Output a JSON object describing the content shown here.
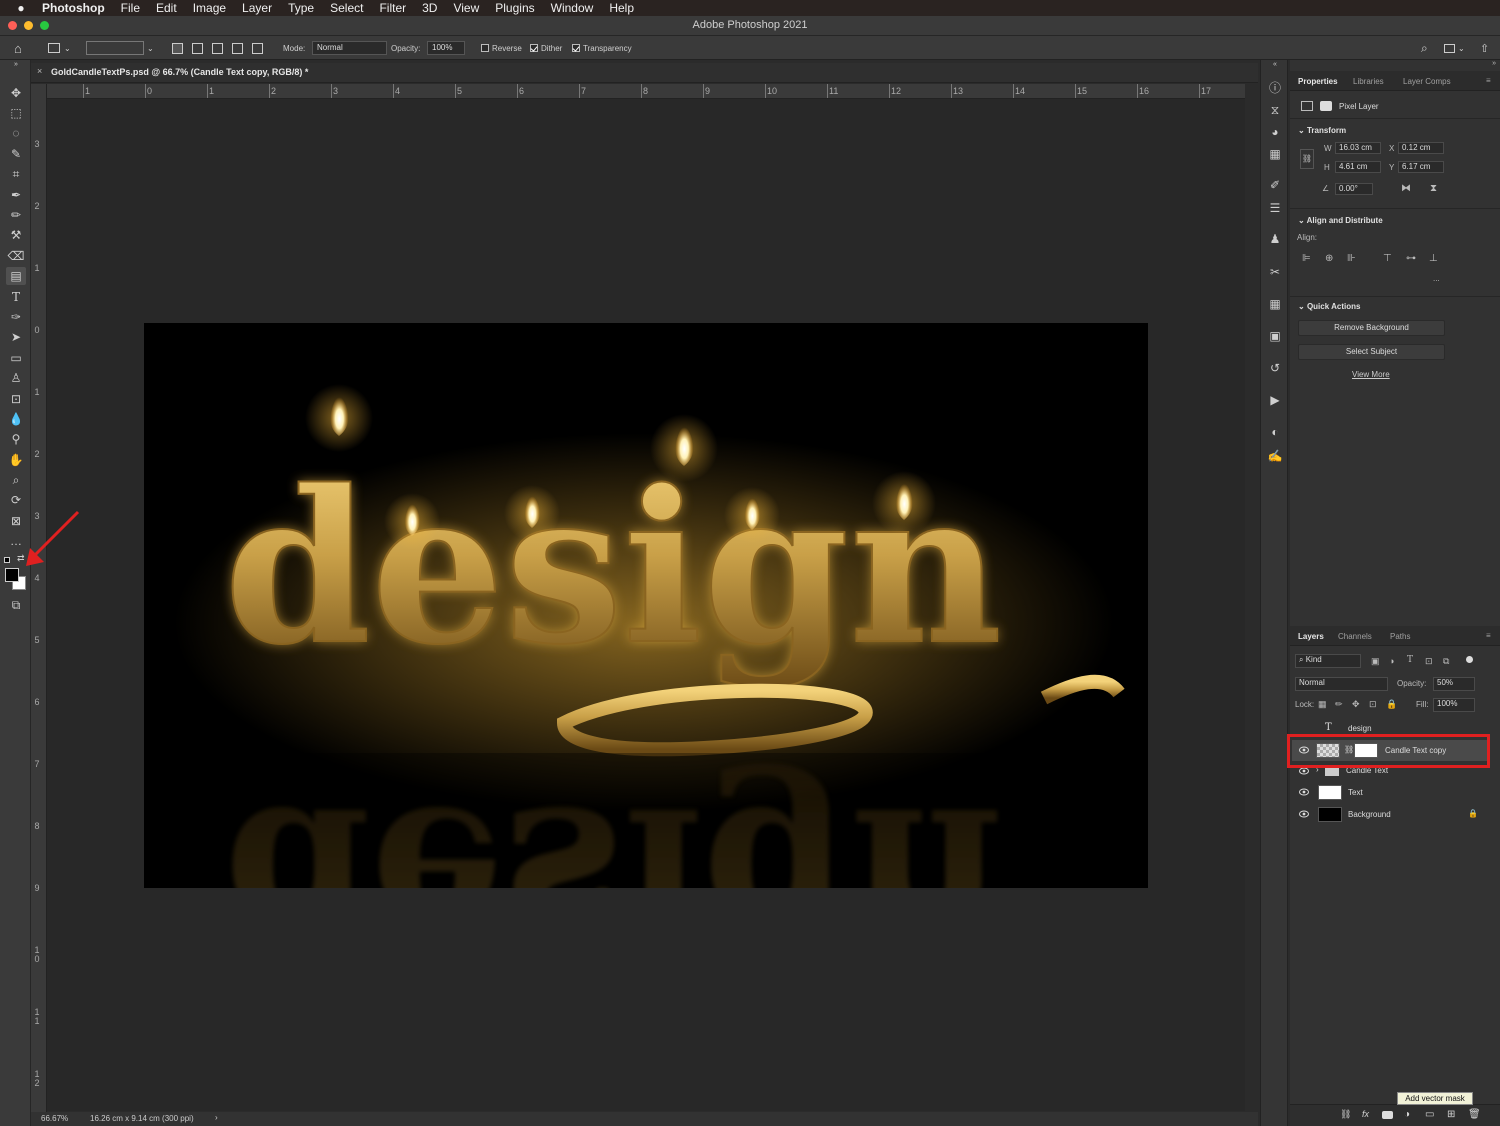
{
  "menubar": {
    "app": "Photoshop",
    "items": [
      "File",
      "Edit",
      "Image",
      "Layer",
      "Type",
      "Select",
      "Filter",
      "3D",
      "View",
      "Plugins",
      "Window",
      "Help"
    ]
  },
  "window": {
    "title": "Adobe Photoshop 2021"
  },
  "options": {
    "mode_label": "Mode:",
    "mode_value": "Normal",
    "opacity_label": "Opacity:",
    "opacity_value": "100%",
    "reverse": "Reverse",
    "dither": "Dither",
    "transparency": "Transparency"
  },
  "document": {
    "tab_title": "GoldCandleTextPs.psd @ 66.7% (Candle Text copy, RGB/8) *"
  },
  "ruler": {
    "top": [
      "1",
      "0",
      "1",
      "2",
      "3",
      "4",
      "5",
      "6",
      "7",
      "8",
      "9",
      "10",
      "11",
      "12",
      "13",
      "14",
      "15",
      "16",
      "17"
    ],
    "left": [
      "3",
      "2",
      "1",
      "0",
      "1",
      "2",
      "3",
      "4",
      "5",
      "6",
      "7",
      "8",
      "9",
      "10",
      "11",
      "12"
    ]
  },
  "canvas": {
    "artwork_text": "design"
  },
  "status": {
    "zoom": "66.67%",
    "doc_size": "16.26 cm x 9.14 cm (300 ppi)",
    "arrow": "›"
  },
  "properties": {
    "tabs": [
      "Properties",
      "Libraries",
      "Layer Comps"
    ],
    "layer_kind": "Pixel Layer",
    "transform_title": "Transform",
    "w_label": "W",
    "w_value": "16.03 cm",
    "x_label": "X",
    "x_value": "0.12 cm",
    "h_label": "H",
    "h_value": "4.61 cm",
    "y_label": "Y",
    "y_value": "6.17 cm",
    "angle_value": "0.00°",
    "align_title": "Align and Distribute",
    "align_label": "Align:",
    "more": "...",
    "quick_title": "Quick Actions",
    "remove_bg": "Remove Background",
    "select_subject": "Select Subject",
    "view_more": "View More"
  },
  "layers": {
    "tabs": [
      "Layers",
      "Channels",
      "Paths"
    ],
    "filter_kind": "Kind",
    "blend_mode": "Normal",
    "opacity_label": "Opacity:",
    "opacity_value": "50%",
    "lock_label": "Lock:",
    "fill_label": "Fill:",
    "fill_value": "100%",
    "list": [
      {
        "name": "design"
      },
      {
        "name": "Candle Text copy"
      },
      {
        "name": "Candle Text"
      },
      {
        "name": "Text"
      },
      {
        "name": "Background"
      }
    ],
    "tooltip": "Add vector mask"
  },
  "colors": {
    "highlight": "#e02020",
    "gold": "#c9a048",
    "panel": "#323232"
  }
}
